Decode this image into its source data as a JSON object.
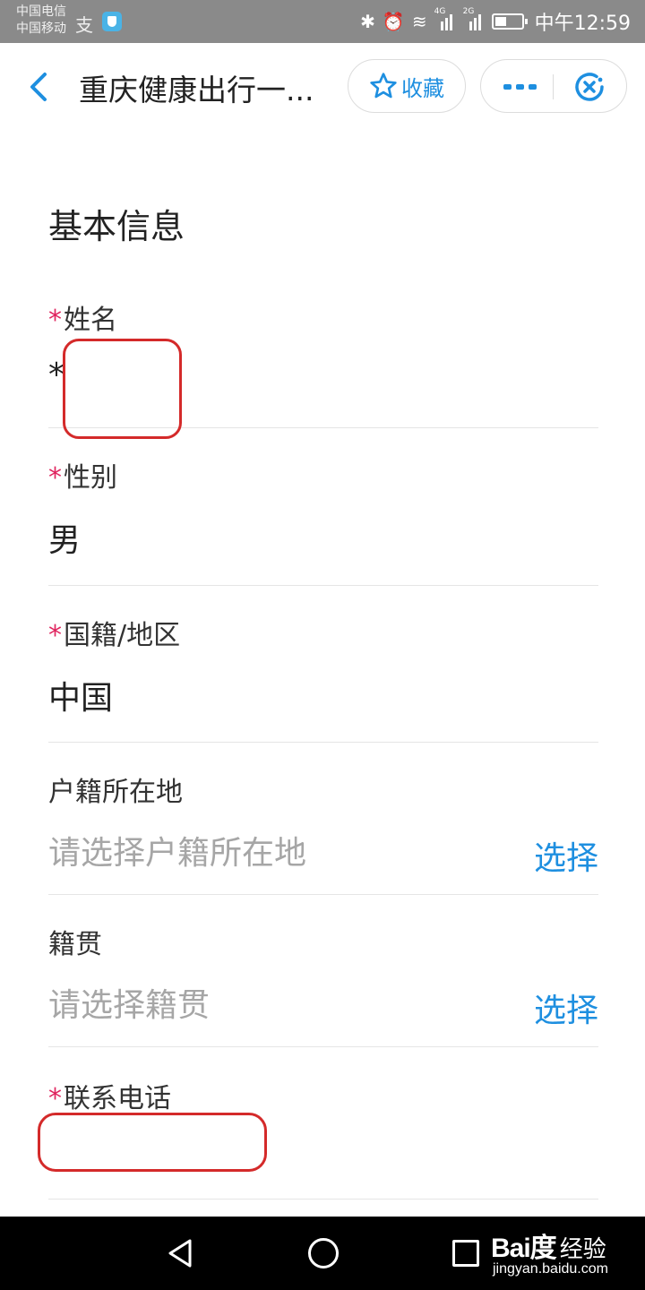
{
  "status_bar": {
    "carrier_1": "中国电信",
    "carrier_2": "中国移动",
    "sig1_label": "4G",
    "sig2_label": "2G",
    "time": "中午12:59"
  },
  "header": {
    "title": "重庆健康出行一...",
    "favorite_label": "收藏"
  },
  "form": {
    "section_title": "基本信息",
    "name": {
      "required_mark": "*",
      "label": "姓名",
      "value": "*"
    },
    "gender": {
      "required_mark": "*",
      "label": "性别",
      "value": "男"
    },
    "nationality": {
      "required_mark": "*",
      "label": "国籍/地区",
      "value": "中国"
    },
    "household_registration": {
      "label": "户籍所在地",
      "placeholder": "请选择户籍所在地",
      "action": "选择"
    },
    "native_place": {
      "label": "籍贯",
      "placeholder": "请选择籍贯",
      "action": "选择"
    },
    "phone": {
      "required_mark": "*",
      "label": "联系电话",
      "value": ""
    }
  },
  "watermark": {
    "logo": "Bai度",
    "label": "经验",
    "url": "jingyan.baidu.com"
  },
  "colors": {
    "accent": "#1e8fe0",
    "required": "#e0245e",
    "annotation": "#d42a2a",
    "status_bar": "#8a8a8a"
  }
}
